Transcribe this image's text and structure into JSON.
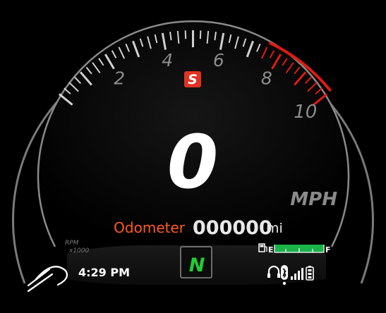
{
  "tach": {
    "labels": [
      "2",
      "4",
      "6",
      "8",
      "10"
    ],
    "unit_line1": "RPM",
    "unit_line2": "x1000",
    "redline_from": 7.5,
    "max": 10
  },
  "mode_badge": "S",
  "speed": {
    "value": "0",
    "unit": "MPH"
  },
  "odometer": {
    "label": "Odometer",
    "value": "000000",
    "unit": "mi"
  },
  "gear": "N",
  "clock": "4:29 PM",
  "fuel": {
    "empty_label": "E",
    "full_label": "F",
    "level_fraction": 1.0
  },
  "status_icons": [
    "headset-icon",
    "bluetooth-icon",
    "signal-bars-icon",
    "phone-battery-icon"
  ],
  "colors": {
    "odometer_label": "#ff5a1e",
    "redline": "#e01b10",
    "mode_badge": "#e03323",
    "gear": "#22cc33",
    "fuel_bar": "#19b34a"
  }
}
